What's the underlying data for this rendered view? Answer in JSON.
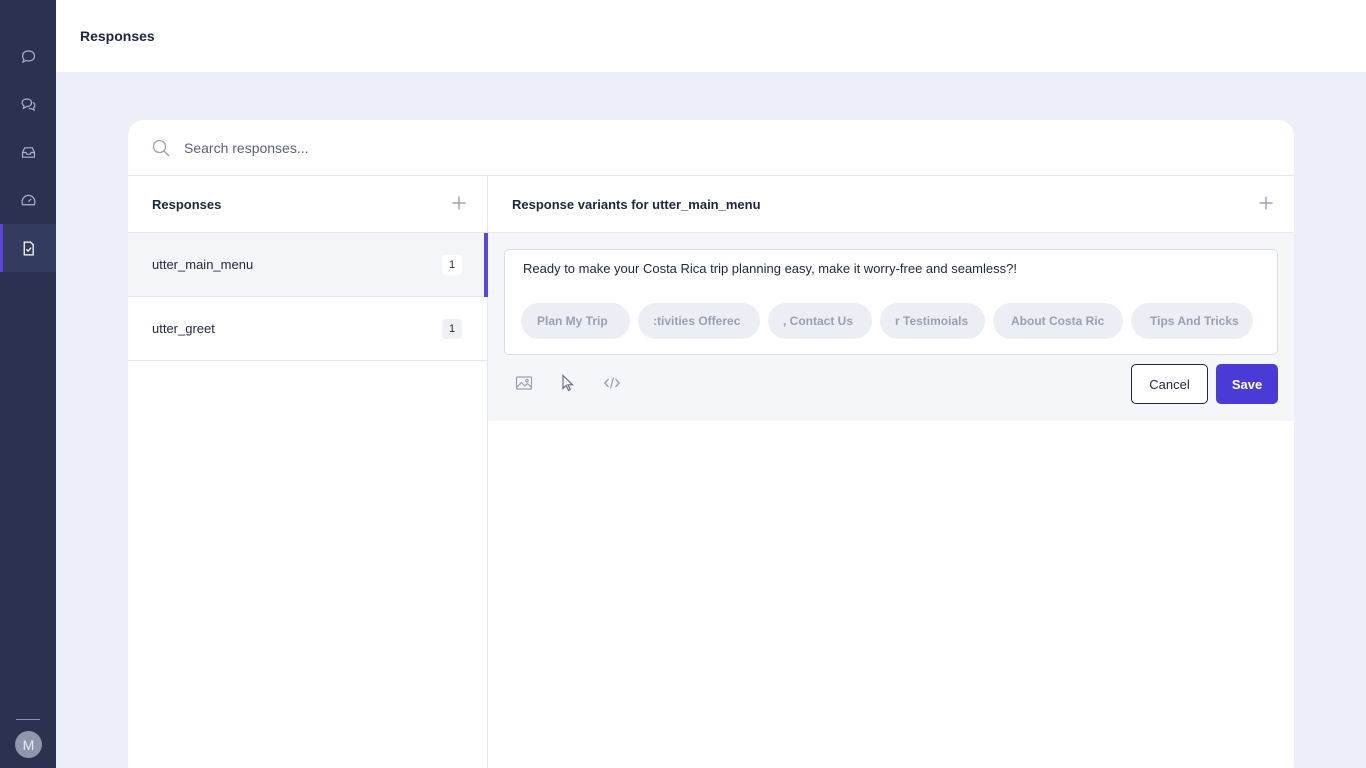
{
  "sidebar": {
    "items": [
      {
        "icon": "chat-bubble-icon",
        "active": false
      },
      {
        "icon": "conversations-icon",
        "active": false
      },
      {
        "icon": "inbox-icon",
        "active": false
      },
      {
        "icon": "dashboard-gauge-icon",
        "active": false
      },
      {
        "icon": "responses-document-icon",
        "active": true
      }
    ],
    "avatar_initial": "M"
  },
  "header": {
    "title": "Responses"
  },
  "search": {
    "placeholder": "Search responses..."
  },
  "responses_panel": {
    "title": "Responses",
    "items": [
      {
        "name": "utter_main_menu",
        "count": "1",
        "active": true
      },
      {
        "name": "utter_greet",
        "count": "1",
        "active": false
      }
    ]
  },
  "variants_panel": {
    "title": "Response variants for utter_main_menu",
    "variant": {
      "text": "Ready to make your Costa Rica trip planning easy, make it worry-free and seamless?!",
      "buttons": [
        {
          "visible_text": "Plan My Trip"
        },
        {
          "visible_text": ":tivities Offerec"
        },
        {
          "visible_text": ", Contact Us"
        },
        {
          "visible_text": "r Testimoials"
        },
        {
          "visible_text": "About Costa Ric"
        },
        {
          "visible_text": "Tips And Tricks"
        }
      ]
    },
    "cancel_label": "Cancel",
    "save_label": "Save"
  },
  "colors": {
    "sidebar_bg": "#2b3150",
    "accent": "#4b3bd6",
    "page_bg": "#eceff7"
  }
}
